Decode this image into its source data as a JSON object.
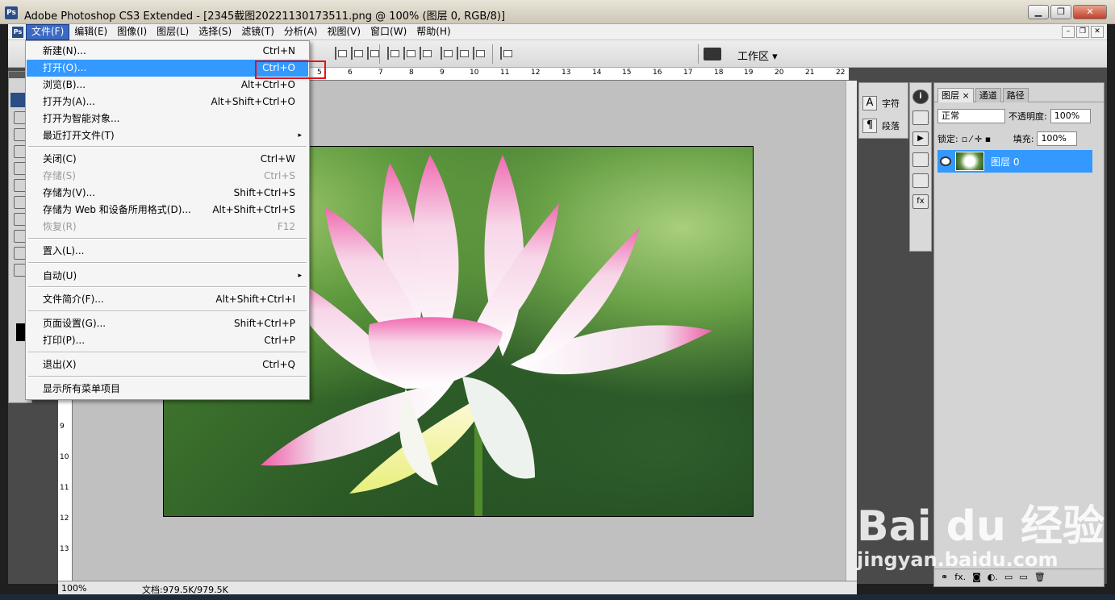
{
  "window": {
    "logo": "Ps",
    "title": "Adobe Photoshop CS3 Extended - [2345截图20221130173511.png @ 100% (图层 0, RGB/8)]",
    "controls": [
      "▁",
      "❐",
      "✕"
    ]
  },
  "menubar": {
    "logo": "Ps",
    "items": [
      "文件(F)",
      "编辑(E)",
      "图像(I)",
      "图层(L)",
      "选择(S)",
      "滤镜(T)",
      "分析(A)",
      "视图(V)",
      "窗口(W)",
      "帮助(H)"
    ],
    "doc_controls": [
      "–",
      "❐",
      "✕"
    ]
  },
  "options": {
    "workspace": "工作区 ▾"
  },
  "file_menu": {
    "items": [
      {
        "label": "新建(N)...",
        "shortcut": "Ctrl+N"
      },
      {
        "label": "打开(O)...",
        "shortcut": "Ctrl+O",
        "highlight": true
      },
      {
        "label": "浏览(B)...",
        "shortcut": "Alt+Ctrl+O"
      },
      {
        "label": "打开为(A)...",
        "shortcut": "Alt+Shift+Ctrl+O"
      },
      {
        "label": "打开为智能对象...",
        "shortcut": ""
      },
      {
        "label": "最近打开文件(T)",
        "shortcut": "",
        "submenu": "▸"
      },
      {
        "label": "关闭(C)",
        "shortcut": "Ctrl+W"
      },
      {
        "label": "存储(S)",
        "shortcut": "Ctrl+S",
        "disabled": true
      },
      {
        "label": "存储为(V)...",
        "shortcut": "Shift+Ctrl+S"
      },
      {
        "label": "存储为 Web 和设备所用格式(D)...",
        "shortcut": "Alt+Shift+Ctrl+S"
      },
      {
        "label": "恢复(R)",
        "shortcut": "F12",
        "disabled": true
      },
      {
        "label": "置入(L)...",
        "shortcut": ""
      },
      {
        "label": "自动(U)",
        "shortcut": "",
        "submenu": "▸"
      },
      {
        "label": "文件简介(F)...",
        "shortcut": "Alt+Shift+Ctrl+I"
      },
      {
        "label": "页面设置(G)...",
        "shortcut": "Shift+Ctrl+P"
      },
      {
        "label": "打印(P)...",
        "shortcut": "Ctrl+P"
      },
      {
        "label": "退出(X)",
        "shortcut": "Ctrl+Q"
      },
      {
        "label": "显示所有菜单项目",
        "shortcut": ""
      }
    ]
  },
  "ruler": {
    "top_labels": [
      "5",
      "6",
      "7",
      "8",
      "9",
      "10",
      "11",
      "12",
      "13",
      "14",
      "15",
      "16",
      "17",
      "18",
      "19",
      "20",
      "21",
      "22"
    ],
    "left_labels": [
      "9",
      "10",
      "11",
      "12",
      "13"
    ]
  },
  "status": {
    "zoom": "100%",
    "doc": "文档:979.5K/979.5K"
  },
  "char_panel": {
    "items": [
      {
        "icon": "A",
        "label": "字符"
      },
      {
        "icon": "¶",
        "label": "段落"
      }
    ]
  },
  "layers": {
    "tabs": [
      "图层 ×",
      "通道",
      "路径"
    ],
    "blend_mode": "正常",
    "opacity_label": "不透明度:",
    "opacity": "100%",
    "lock_label": "锁定:",
    "fill_label": "填充:",
    "fill": "100%",
    "layer_name": "图层 0",
    "bottom_icons": [
      "⚭",
      "fx.",
      "◙",
      "◐.",
      "▭",
      "▭",
      "🗑"
    ]
  },
  "watermark": {
    "brand": "Bai du 经验",
    "url": "jingyan.baidu.com"
  },
  "colors": {
    "menu_highlight": "#3399ff",
    "red_box": "#e8101a"
  }
}
